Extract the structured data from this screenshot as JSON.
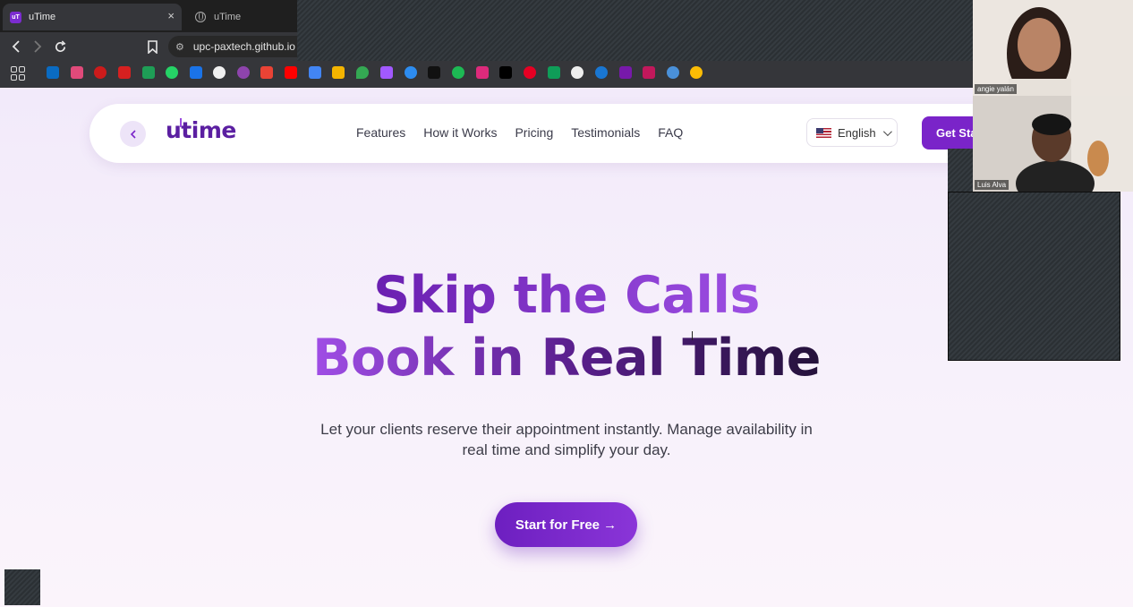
{
  "browser": {
    "tabs": [
      {
        "title": "uTime",
        "active": true,
        "favicon": "utime-favicon"
      },
      {
        "title": "uTime",
        "active": false,
        "favicon": "globe-icon"
      }
    ],
    "address": "upc-paxtech.github.io",
    "close_glyph": "×"
  },
  "navbar": {
    "logo": "utime",
    "links": [
      "Features",
      "How it Works",
      "Pricing",
      "Testimonials",
      "FAQ"
    ],
    "language": "English",
    "cta": "Get Sta"
  },
  "hero": {
    "title_line1": "Skip the Calls",
    "title_line2": "Book in Real Time",
    "subtitle_line1": "Let your clients reserve their appointment instantly. Manage availability in",
    "subtitle_line2": "real time and simplify your day.",
    "cta": "Start for Free →"
  },
  "call": {
    "participants": [
      {
        "name": "angie yalán"
      },
      {
        "name": "Luis Alva"
      }
    ]
  },
  "colors": {
    "brand_purple": "#7a24c9",
    "accent_purple": "#9d4fe3",
    "dark_text": "#24123a"
  }
}
